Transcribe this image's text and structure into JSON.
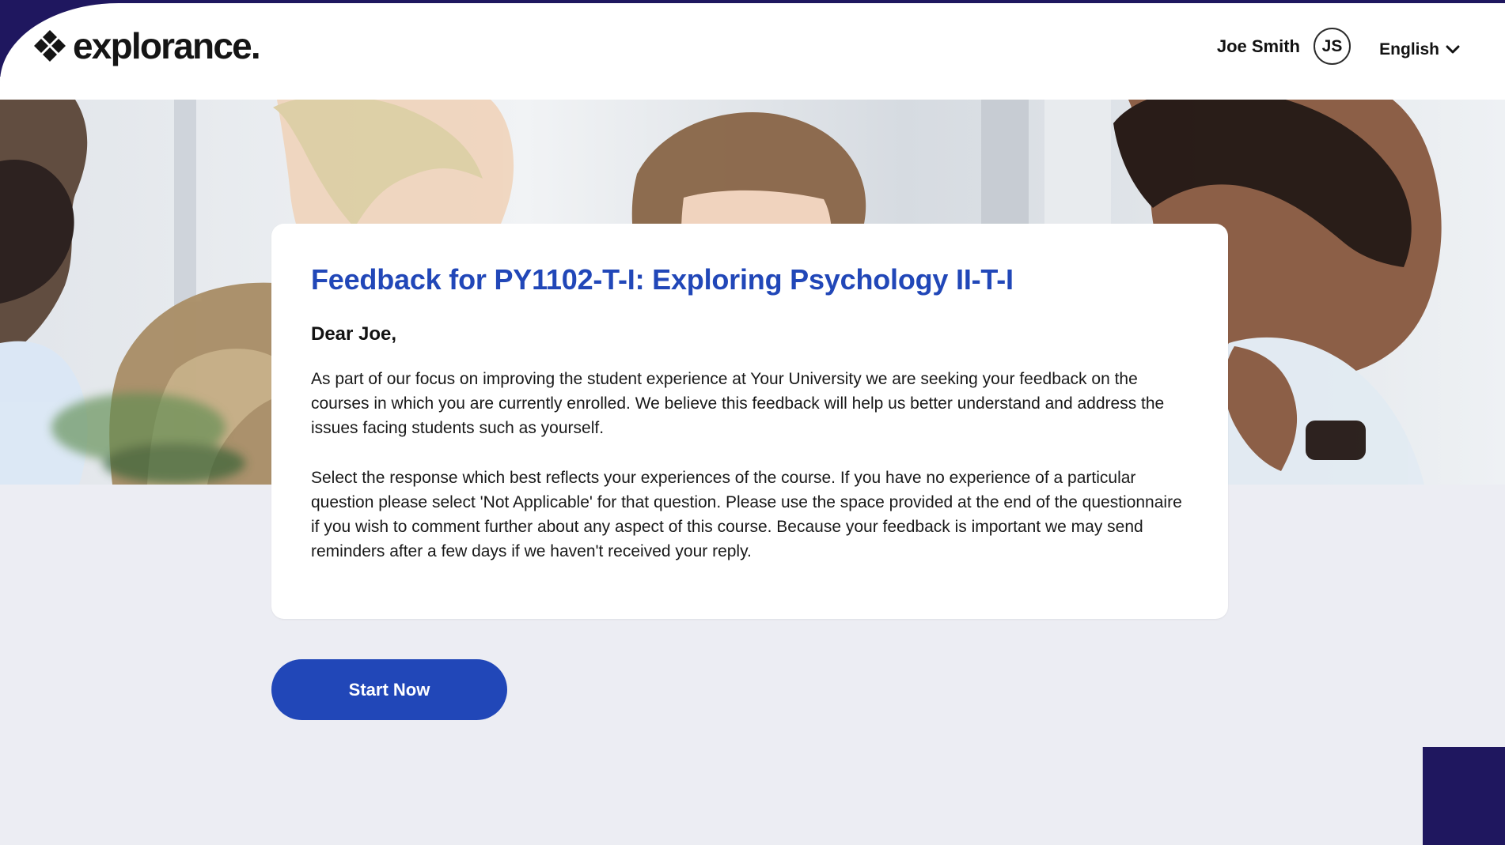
{
  "brand": {
    "name": "explorance.",
    "logo_icon": "explorance-logo-icon"
  },
  "header": {
    "user_name": "Joe Smith",
    "avatar_initials": "JS",
    "language": "English",
    "language_icon": "chevron-down-icon"
  },
  "hero": {
    "image": "people-discussion-photo"
  },
  "card": {
    "title": "Feedback for PY1102-T-I: Exploring Psychology II-T-I",
    "greeting": "Dear Joe,",
    "paragraphs": [
      "As part of our focus on improving the student experience at Your University we are seeking your feedback on the courses in which you are currently enrolled. We believe this feedback will help us better understand and address the issues facing students such as yourself.",
      "Select the response which best reflects your experiences of the course. If you have no experience of a particular question please select 'Not Applicable' for that question. Please use the space provided at the end of the questionnaire if you wish to comment further about any aspect of this course. Because your feedback is important we may send reminders after a few days if we haven't received your reply."
    ]
  },
  "actions": {
    "start_label": "Start Now"
  },
  "colors": {
    "accent": "#2147b8",
    "frame": "#1f175f",
    "background": "#ecedf3",
    "card": "#ffffff",
    "text": "#121212"
  }
}
